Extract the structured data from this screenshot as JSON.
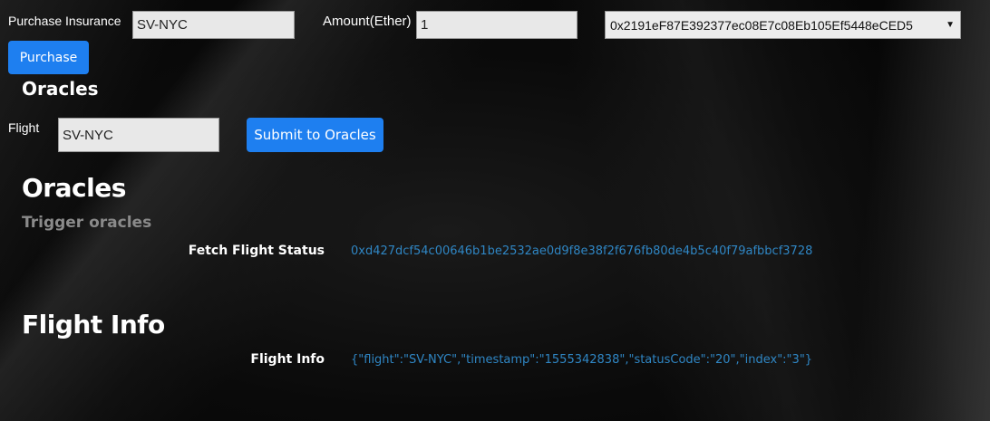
{
  "purchase": {
    "insurance_label": "Purchase Insurance",
    "flight_value": "SV-NYC",
    "amount_label": "Amount(Ether)",
    "amount_value": "1",
    "account_selected": "0x2191eF87E392377ec08E7c08Eb105Ef5448eCED5",
    "button_label": "Purchase"
  },
  "oracles_form": {
    "heading": "Oracles",
    "flight_label": "Flight",
    "flight_value": "SV-NYC",
    "submit_label": "Submit to Oracles"
  },
  "oracles_section": {
    "title": "Oracles",
    "subtitle": "Trigger oracles",
    "row_label": "Fetch Flight Status",
    "row_value": "0xd427dcf54c00646b1be2532ae0d9f8e38f2f676fb80de4b5c40f79afbbcf3728"
  },
  "flight_info_section": {
    "title": "Flight Info",
    "row_label": "Flight Info",
    "row_value": "{\"flight\":\"SV-NYC\",\"timestamp\":\"1555342838\",\"statusCode\":\"20\",\"index\":\"3\"}"
  },
  "icons": {
    "select_caret": "▼"
  }
}
